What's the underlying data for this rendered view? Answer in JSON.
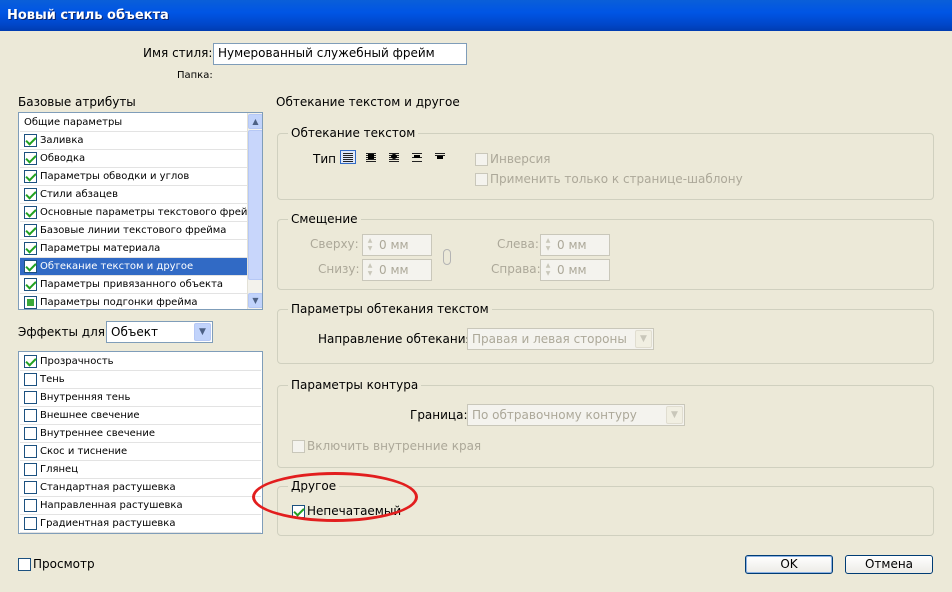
{
  "window": {
    "title": "Новый стиль объекта"
  },
  "style_name": {
    "label": "Имя стиля:",
    "value": "Нумерованный служебный фрейм",
    "folder_label": "Папка:"
  },
  "basic_attributes": {
    "heading": "Базовые атрибуты",
    "items": [
      {
        "label": "Общие параметры",
        "state": "none"
      },
      {
        "label": "Заливка",
        "state": "checked"
      },
      {
        "label": "Обводка",
        "state": "checked"
      },
      {
        "label": "Параметры обводки и углов",
        "state": "checked"
      },
      {
        "label": "Стили абзацев",
        "state": "checked"
      },
      {
        "label": "Основные параметры текстового фрейма",
        "state": "checked"
      },
      {
        "label": "Базовые линии текстового фрейма",
        "state": "checked"
      },
      {
        "label": "Параметры материала",
        "state": "checked"
      },
      {
        "label": "Обтекание текстом и другое",
        "state": "checked",
        "selected": true
      },
      {
        "label": "Параметры привязанного объекта",
        "state": "checked"
      },
      {
        "label": "Параметры подгонки фрейма",
        "state": "partial"
      }
    ]
  },
  "effects_for": {
    "label": "Эффекты для:",
    "value": "Объект",
    "items": [
      {
        "label": "Прозрачность",
        "state": "checked"
      },
      {
        "label": "Тень",
        "state": "unchecked"
      },
      {
        "label": "Внутренняя тень",
        "state": "unchecked"
      },
      {
        "label": "Внешнее свечение",
        "state": "unchecked"
      },
      {
        "label": "Внутреннее свечение",
        "state": "unchecked"
      },
      {
        "label": "Скос и тиснение",
        "state": "unchecked"
      },
      {
        "label": "Глянец",
        "state": "unchecked"
      },
      {
        "label": "Стандартная растушевка",
        "state": "unchecked"
      },
      {
        "label": "Направленная растушевка",
        "state": "unchecked"
      },
      {
        "label": "Градиентная растушевка",
        "state": "unchecked"
      }
    ]
  },
  "panel": {
    "title": "Обтекание текстом и другое"
  },
  "text_wrap": {
    "title": "Обтекание текстом",
    "type_label": "Тип",
    "invert_label": "Инверсия",
    "master_only_label": "Применить только к странице-шаблону"
  },
  "offset": {
    "title": "Смещение",
    "top_label": "Сверху:",
    "top_value": "0 мм",
    "bottom_label": "Снизу:",
    "bottom_value": "0 мм",
    "left_label": "Слева:",
    "left_value": "0 мм",
    "right_label": "Справа:",
    "right_value": "0 мм"
  },
  "wrap_options": {
    "title": "Параметры обтекания текстом",
    "direction_label": "Направление обтекания:",
    "direction_value": "Правая и левая стороны"
  },
  "contour_options": {
    "title": "Параметры контура",
    "border_label": "Граница:",
    "border_value": "По обтравочному контуру",
    "include_inside_label": "Включить внутренние края"
  },
  "other": {
    "title": "Другое",
    "nonprinting_label": "Непечатаемый",
    "nonprinting_checked": true
  },
  "footer": {
    "preview_label": "Просмотр",
    "ok_label": "OK",
    "cancel_label": "Отмена"
  },
  "colors": {
    "title_bar": "#0054e3",
    "selection": "#316ac5",
    "highlight_ellipse": "#e21e1e"
  }
}
